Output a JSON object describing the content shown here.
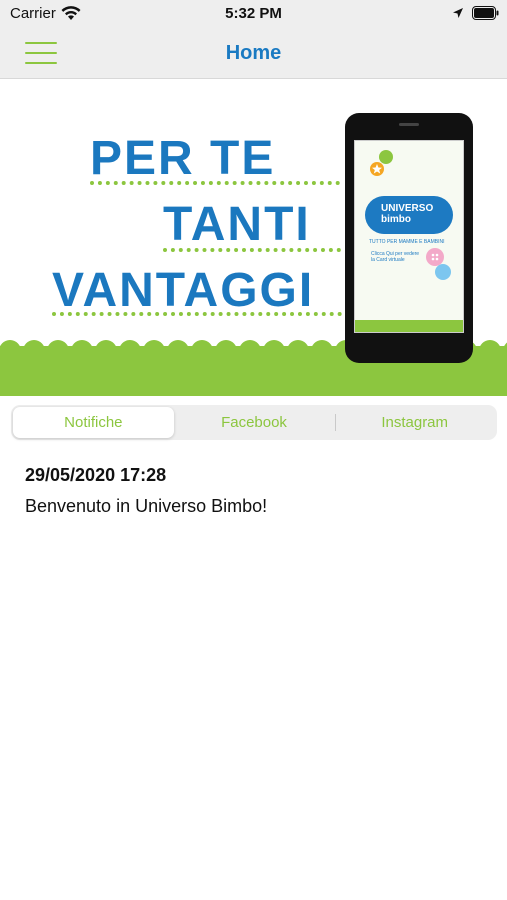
{
  "status_bar": {
    "carrier": "Carrier",
    "time": "5:32 PM"
  },
  "nav": {
    "title": "Home",
    "accent_color": "#1a7ac2"
  },
  "banner": {
    "lines": [
      "PER TE",
      "TANTI",
      "VANTAGGI"
    ],
    "phone": {
      "logo_top": "UNIVERSO",
      "logo_bottom": "bimbo",
      "tagline": "TUTTO PER MAMME E BAMBINI",
      "cta": "Clicca Qui per vedere la Card virtuale"
    },
    "colors": {
      "blue": "#1b78bf",
      "green": "#8cc63f"
    }
  },
  "tabs": [
    {
      "label": "Notifiche",
      "active": true
    },
    {
      "label": "Facebook",
      "active": false
    },
    {
      "label": "Instagram",
      "active": false
    }
  ],
  "notifications": [
    {
      "date": "29/05/2020 17:28",
      "text": "Benvenuto in Universo Bimbo!"
    }
  ]
}
